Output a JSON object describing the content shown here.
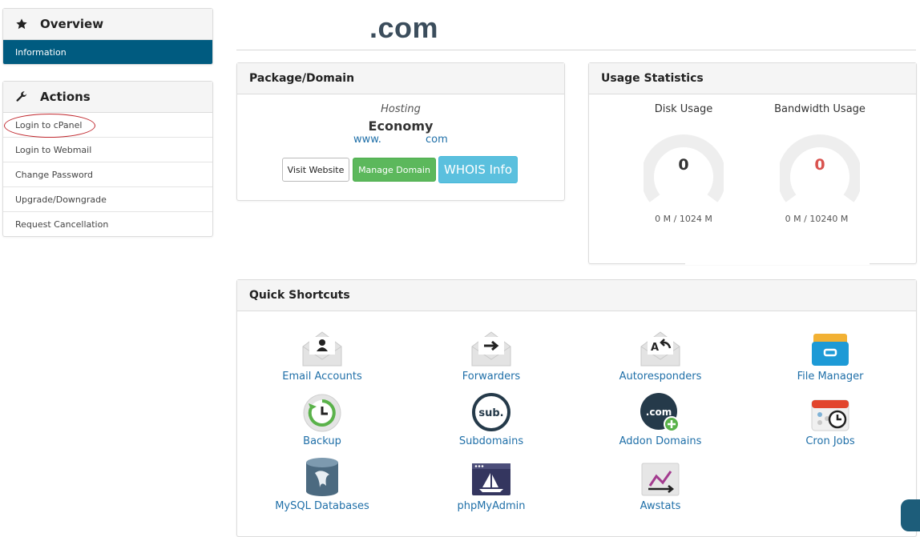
{
  "sidebar": {
    "overview": {
      "title": "Overview",
      "icon": "star-icon",
      "active_item": "Information"
    },
    "actions": {
      "title": "Actions",
      "icon": "wrench-icon",
      "items": [
        {
          "label": "Login to cPanel"
        },
        {
          "label": "Login to Webmail"
        },
        {
          "label": "Change Password"
        },
        {
          "label": "Upgrade/Downgrade"
        },
        {
          "label": "Request Cancellation"
        }
      ]
    }
  },
  "header": {
    "domain_title": ".com"
  },
  "package": {
    "heading": "Package/Domain",
    "type": "Hosting",
    "name": "Economy",
    "domain_prefix": "www.",
    "domain_suffix": "com",
    "buttons": {
      "visit": "Visit Website",
      "manage": "Manage Domain",
      "whois": "WHOIS Info"
    }
  },
  "usage": {
    "heading": "Usage Statistics",
    "disk": {
      "label": "Disk Usage",
      "value": "0",
      "detail": "0 M / 1024 M"
    },
    "bandwidth": {
      "label": "Bandwidth Usage",
      "value": "0",
      "detail": "0 M / 10240 M"
    }
  },
  "shortcuts": {
    "heading": "Quick Shortcuts",
    "items": [
      {
        "label": "Email Accounts",
        "icon": "email-accounts-icon"
      },
      {
        "label": "Forwarders",
        "icon": "forwarders-icon"
      },
      {
        "label": "Autoresponders",
        "icon": "autoresponders-icon"
      },
      {
        "label": "File Manager",
        "icon": "file-manager-icon"
      },
      {
        "label": "Backup",
        "icon": "backup-icon"
      },
      {
        "label": "Subdomains",
        "icon": "subdomains-icon"
      },
      {
        "label": "Addon Domains",
        "icon": "addon-domains-icon"
      },
      {
        "label": "Cron Jobs",
        "icon": "cron-jobs-icon"
      },
      {
        "label": "MySQL Databases",
        "icon": "mysql-databases-icon"
      },
      {
        "label": "phpMyAdmin",
        "icon": "phpmyadmin-icon"
      },
      {
        "label": "Awstats",
        "icon": "awstats-icon"
      }
    ]
  },
  "colors": {
    "primary_nav": "#005b80",
    "success": "#5cb85c",
    "info": "#5bc0de",
    "link": "#1f6fa8",
    "danger_value": "#d9534f"
  }
}
